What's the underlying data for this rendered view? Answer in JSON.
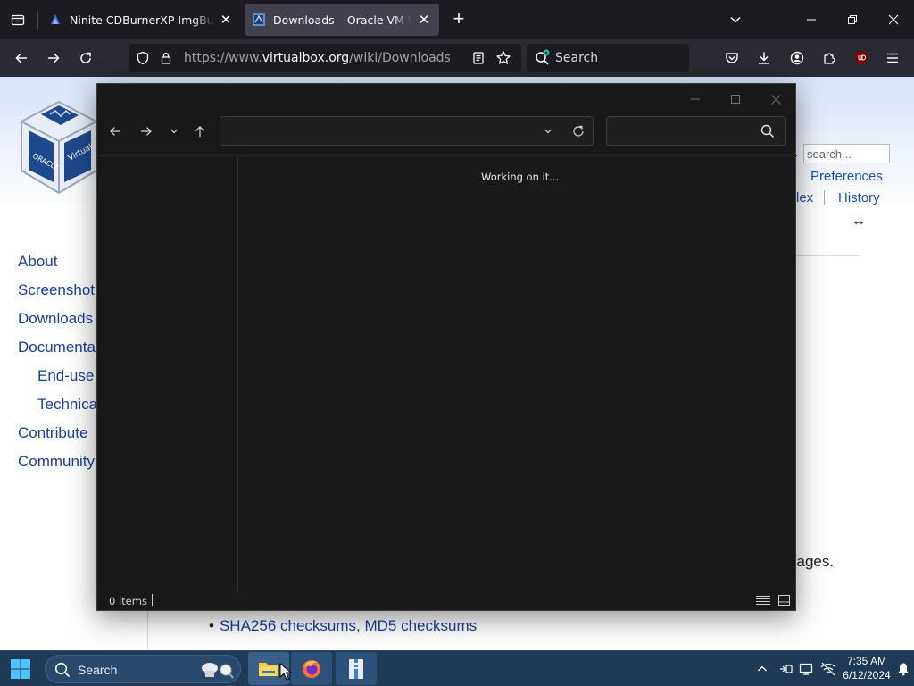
{
  "browser": {
    "tabs": [
      {
        "title": "Ninite CDBurnerXP ImgBurn Ur",
        "close": "✕"
      },
      {
        "title": "Downloads – Oracle VM Virtual",
        "close": "✕"
      }
    ],
    "new_tab": "+",
    "url_prefix": "https://www.",
    "url_domain": "virtualbox.org",
    "url_path": "/wiki/Downloads",
    "search_placeholder": "Search"
  },
  "page": {
    "wiki_search_placeholder": "search...",
    "top_links": {
      "preferences": "Preferences",
      "index_partial": "lex",
      "history": "History"
    },
    "arrow": "↔",
    "sidebar": {
      "items": [
        "About",
        "Screenshot",
        "Downloads",
        "Documenta",
        "End-use",
        "Technica",
        "Contribute",
        "Community"
      ]
    },
    "partial_text": "kages.",
    "bullet": "•",
    "bullet_link": "SHA256 checksums, MD5 checksums"
  },
  "dialog": {
    "status_message": "Working on it...",
    "items_count": "0 items",
    "address_value": "",
    "search_value": ""
  },
  "taskbar": {
    "search_label": "Search",
    "time": "7:35 AM",
    "date": "6/12/2024"
  },
  "colors": {
    "browser_tabbar": "#1c1b22",
    "browser_navbar": "#2b2a33",
    "dialog_bg": "#191919",
    "link": "#1a3fa3",
    "taskbar": "#1f3a57"
  }
}
